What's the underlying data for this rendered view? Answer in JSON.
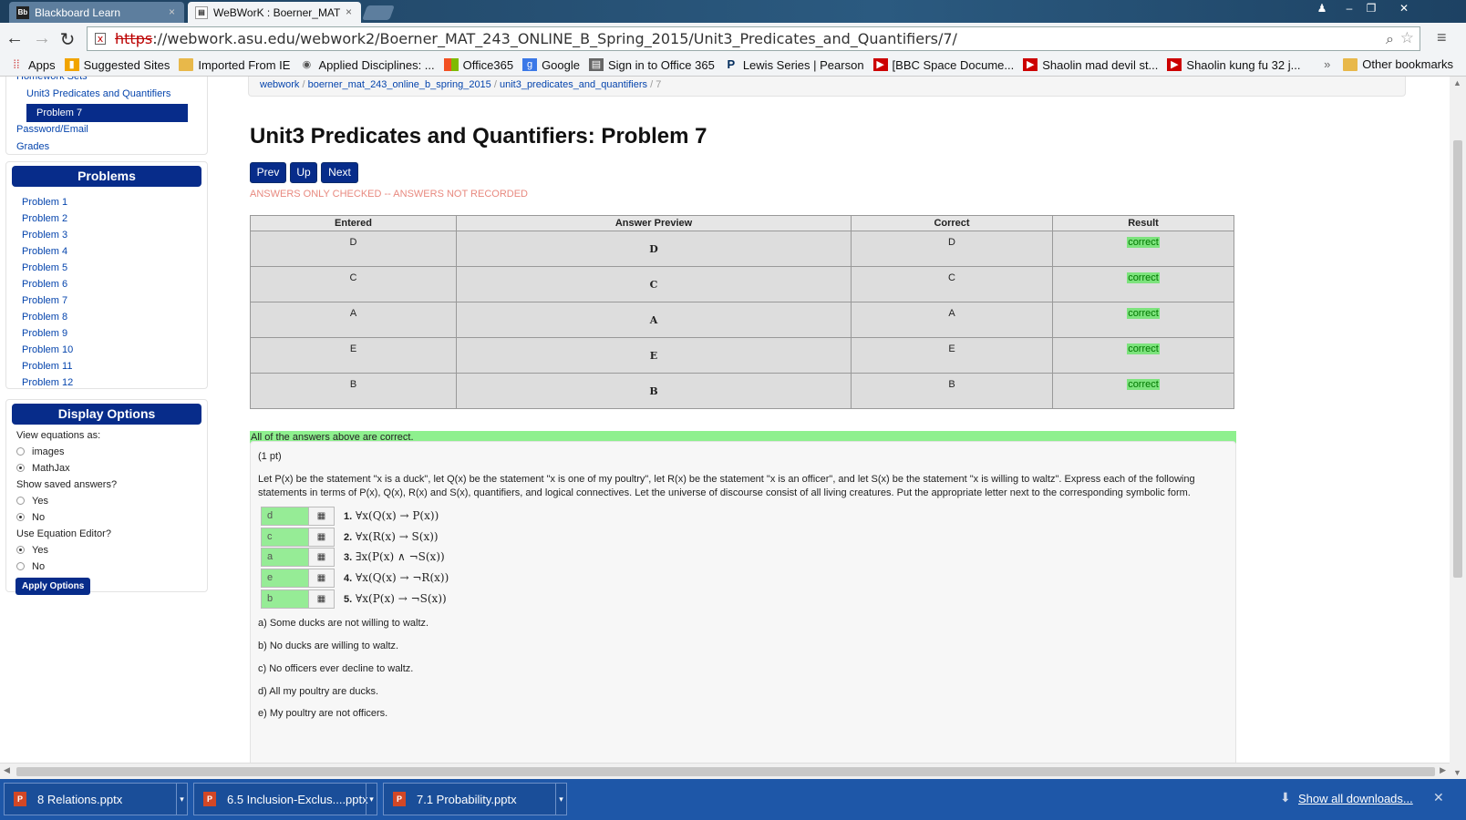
{
  "browser": {
    "tabs": [
      {
        "label": "Blackboard Learn",
        "icon": "blackboard-icon",
        "icon_text": "Bb"
      },
      {
        "label": "WeBWorK : Boerner_MAT",
        "icon": "page-icon"
      }
    ],
    "url_scheme": "https",
    "url_rest": "://webwork.asu.edu/webwork2/Boerner_MAT_243_ONLINE_B_Spring_2015/Unit3_Predicates_and_Quantifiers/7/",
    "bookmarks": [
      {
        "label": "Apps",
        "icon": "apps-grid-icon"
      },
      {
        "label": "Suggested Sites",
        "icon": "suggested-sites-icon"
      },
      {
        "label": "Imported From IE",
        "icon": "folder-icon"
      },
      {
        "label": "Applied Disciplines: ...",
        "icon": "site-icon"
      },
      {
        "label": "Office365",
        "icon": "office-icon"
      },
      {
        "label": "Google",
        "icon": "google-icon"
      },
      {
        "label": "Sign in to Office 365",
        "icon": "page-icon"
      },
      {
        "label": "Lewis Series | Pearson",
        "icon": "pearson-icon",
        "icon_text": "P"
      },
      {
        "label": "[BBC Space Docume...",
        "icon": "youtube-icon"
      },
      {
        "label": "Shaolin mad devil st...",
        "icon": "youtube-icon"
      },
      {
        "label": "Shaolin kung fu 32 j...",
        "icon": "youtube-icon"
      }
    ],
    "overflow": "»",
    "other_bookmarks": "Other bookmarks"
  },
  "sidebar": {
    "homework_sets": "Homework Sets",
    "set_name": "Unit3 Predicates and Quantifiers",
    "current_problem": "Problem 7",
    "links": [
      "Password/Email",
      "Grades"
    ],
    "problems_header": "Problems",
    "problems": [
      "Problem 1",
      "Problem 2",
      "Problem 3",
      "Problem 4",
      "Problem 5",
      "Problem 6",
      "Problem 7",
      "Problem 8",
      "Problem 9",
      "Problem 10",
      "Problem 11",
      "Problem 12"
    ],
    "display_header": "Display Options",
    "view_equations_label": "View equations as:",
    "view_options": [
      "images",
      "MathJax"
    ],
    "view_selected": "MathJax",
    "show_saved_label": "Show saved answers?",
    "show_saved_options": [
      "Yes",
      "No"
    ],
    "show_saved_selected": "No",
    "equation_editor_label": "Use Equation Editor?",
    "equation_editor_options": [
      "Yes",
      "No"
    ],
    "equation_editor_selected": "Yes",
    "apply_label": "Apply Options"
  },
  "main": {
    "breadcrumb": [
      "webwork",
      "boerner_mat_243_online_b_spring_2015",
      "unit3_predicates_and_quantifiers",
      "7"
    ],
    "title": "Unit3 Predicates and Quantifiers: Problem 7",
    "nav": {
      "prev": "Prev",
      "up": "Up",
      "next": "Next"
    },
    "status_message": "ANSWERS ONLY CHECKED -- ANSWERS NOT RECORDED",
    "results_headers": [
      "Entered",
      "Answer Preview",
      "Correct",
      "Result"
    ],
    "results_rows": [
      {
        "entered": "D",
        "preview": "D",
        "correct": "D",
        "result": "correct"
      },
      {
        "entered": "C",
        "preview": "C",
        "correct": "C",
        "result": "correct"
      },
      {
        "entered": "A",
        "preview": "A",
        "correct": "A",
        "result": "correct"
      },
      {
        "entered": "E",
        "preview": "E",
        "correct": "E",
        "result": "correct"
      },
      {
        "entered": "B",
        "preview": "B",
        "correct": "B",
        "result": "correct"
      }
    ],
    "all_correct": "All of the answers above are correct.",
    "points": "(1 pt)",
    "statement": "Let P(x) be the statement \"x is a duck\", let Q(x) be the statement \"x is one of my poultry\", let R(x) be the statement \"x is an officer\", and let S(x) be the statement \"x is willing to waltz\". Express each of the following statements in terms of P(x), Q(x), R(x) and S(x), quantifiers, and logical connectives. Let the universe of discourse consist of all living creatures. Put the appropriate letter next to the corresponding symbolic form.",
    "answers": [
      {
        "value": "d",
        "num": "1.",
        "formula": "∀x(Q(x) → P(x))"
      },
      {
        "value": "c",
        "num": "2.",
        "formula": "∀x(R(x) → S(x))"
      },
      {
        "value": "a",
        "num": "3.",
        "formula": "∃x(P(x) ∧ ¬S(x))"
      },
      {
        "value": "e",
        "num": "4.",
        "formula": "∀x(Q(x) → ¬R(x))"
      },
      {
        "value": "b",
        "num": "5.",
        "formula": "∀x(P(x) → ¬S(x))"
      }
    ],
    "choices": [
      "a) Some ducks are not willing to waltz.",
      "b) No ducks are willing to waltz.",
      "c) No officers ever decline to waltz.",
      "d) All my poultry are ducks.",
      "e) My poultry are not officers."
    ]
  },
  "downloads": {
    "items": [
      "8 Relations.pptx",
      "6.5 Inclusion-Exclus....pptx",
      "7.1 Probability.pptx"
    ],
    "show_all": "Show all downloads..."
  },
  "colors": {
    "accent": "#072c8a",
    "correct_bg": "#8ef08e",
    "status_text": "#e8897f",
    "download_bar": "#1e57a8"
  }
}
